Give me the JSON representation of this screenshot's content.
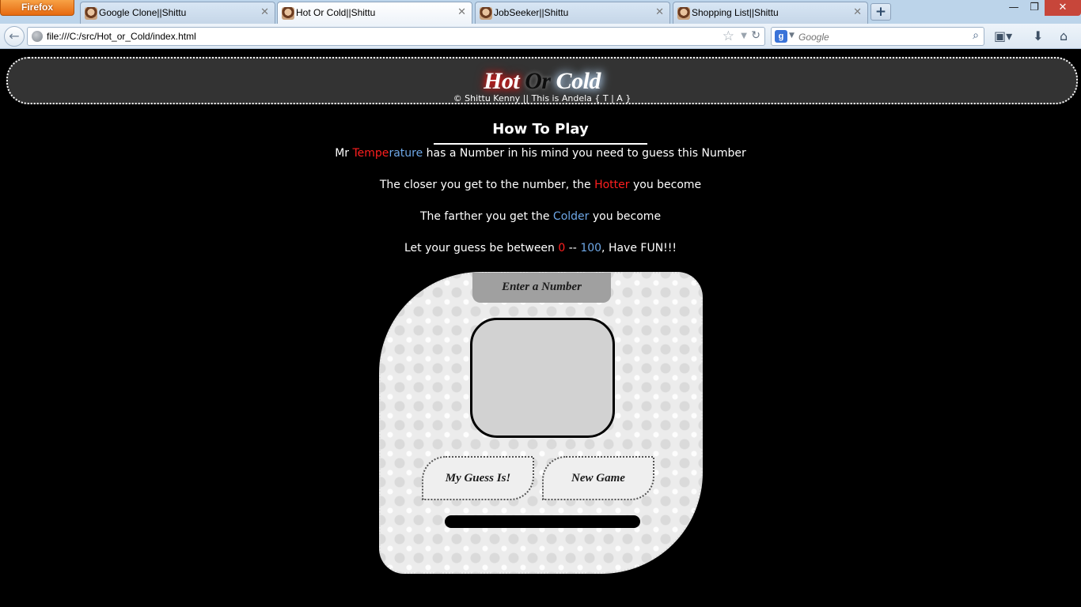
{
  "browser": {
    "menu_button": "Firefox",
    "tabs": [
      {
        "label": "Google Clone||Shittu"
      },
      {
        "label": "Hot Or Cold||Shittu"
      },
      {
        "label": "JobSeeker||Shittu"
      },
      {
        "label": "Shopping List||Shittu"
      }
    ],
    "new_tab": "+",
    "url": "file:///C:/src/Hot_or_Cold/index.html",
    "search_placeholder": "Google",
    "icons": [
      "back-icon",
      "globe-icon",
      "bookmark-star-icon",
      "reload-icon",
      "google-search-icon",
      "magnifier-icon",
      "bookmarks-icon",
      "download-icon",
      "home-icon"
    ]
  },
  "header": {
    "logo_hot": "Hot",
    "logo_or": "Or",
    "logo_cold": "Cold",
    "copyright": "© Shittu Kenny || This is Andela { T | A }"
  },
  "howto": {
    "title": "How To Play",
    "line1": {
      "pre": "Mr ",
      "red": "Tempe",
      "post_red": "rature",
      "rest": " has a Number in his mind you need to guess this Number"
    },
    "line2": {
      "pre": "The closer you get to the number, the ",
      "red": "Hotter",
      "post": " you become"
    },
    "line3": {
      "pre": "The farther you get the ",
      "blue": "Colder",
      "post": " you become"
    },
    "line4": {
      "pre": "Let your guess be between ",
      "min": "0",
      "sep": " -- ",
      "max": "100",
      "post": ", Have FUN!!!"
    }
  },
  "game": {
    "prompt": "Enter a Number",
    "guess_value": "",
    "guess_button": "My Guess Is!",
    "new_game_button": "New Game",
    "feedback": ""
  },
  "colors": {
    "hot": "#ff1f1f",
    "cold": "#6ea7e6",
    "background": "#000000",
    "panel": "#ececec"
  }
}
